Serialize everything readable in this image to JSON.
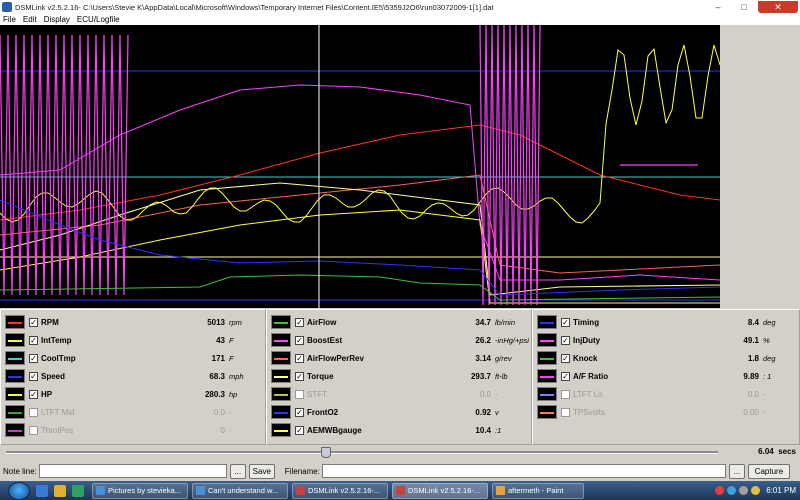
{
  "window": {
    "title": "DSMLink v2.5.2.16- C:\\Users\\Stevie K\\AppData\\Local\\Microsoft\\Windows\\Temporary Internet Files\\Content.IE5\\5359J2O6\\run03072009-1[1].dat",
    "minimize": "–",
    "maximize": "□",
    "close": "✕"
  },
  "menu": [
    "File",
    "Edit",
    "Display",
    "ECU/Logfile"
  ],
  "colors": {
    "chart_bg": "#000000",
    "rpm": "#ff3030",
    "inttemp": "#ffff40",
    "cooltmp": "#40d0d0",
    "speed": "#3030ff",
    "hp": "#ffff40",
    "ltft_mid": "#40a040",
    "throtpos": "#c040c0",
    "airflow": "#40c040",
    "boostest": "#ff40ff",
    "airflowperrev": "#ff6060",
    "torque": "#ffff90",
    "stft": "#c0c040",
    "fronto2": "#3030ff",
    "aemwbgauge": "#ffff40",
    "timing": "#3030ff",
    "injduty": "#ff40ff",
    "knock": "#40c040",
    "afratio": "#ff40ff",
    "ltft_lo": "#8080ff",
    "tpsvolts": "#ff8040"
  },
  "panels": [
    [
      {
        "label": "RPM",
        "value": "5013",
        "unit": "rpm",
        "checked": true,
        "color": "#ff3030"
      },
      {
        "label": "IntTemp",
        "value": "43",
        "unit": "F",
        "checked": true,
        "color": "#ffff40"
      },
      {
        "label": "CoolTmp",
        "value": "171",
        "unit": "F",
        "checked": true,
        "color": "#40d0d0"
      },
      {
        "label": "Speed",
        "value": "68.3",
        "unit": "mph",
        "checked": true,
        "color": "#3030ff"
      },
      {
        "label": "HP",
        "value": "280.3",
        "unit": "hp",
        "checked": true,
        "color": "#ffff40"
      },
      {
        "label": "LTFT Mid",
        "value": "0.0",
        "unit": "-",
        "checked": false,
        "color": "#40a040"
      },
      {
        "label": "ThrotPos",
        "value": "0",
        "unit": "-",
        "checked": false,
        "color": "#c040c0"
      }
    ],
    [
      {
        "label": "AirFlow",
        "value": "34.7",
        "unit": "lb/min",
        "checked": true,
        "color": "#40c040"
      },
      {
        "label": "BoostEst",
        "value": "26.2",
        "unit": "-inHg/+psi",
        "checked": true,
        "color": "#ff40ff"
      },
      {
        "label": "AirFlowPerRev",
        "value": "3.14",
        "unit": "g/rev",
        "checked": true,
        "color": "#ff6060"
      },
      {
        "label": "Torque",
        "value": "293.7",
        "unit": "ft-lb",
        "checked": true,
        "color": "#ffff90"
      },
      {
        "label": "STFT",
        "value": "0.0",
        "unit": "-",
        "checked": false,
        "color": "#c0c040"
      },
      {
        "label": "FrontO2",
        "value": "0.92",
        "unit": "v",
        "checked": true,
        "color": "#3030ff"
      },
      {
        "label": "AEMWBgauge",
        "value": "10.4",
        "unit": ":1",
        "checked": true,
        "color": "#ffff40"
      }
    ],
    [
      {
        "label": "Timing",
        "value": "8.4",
        "unit": "deg",
        "checked": true,
        "color": "#3030ff"
      },
      {
        "label": "InjDuty",
        "value": "49.1",
        "unit": "%",
        "checked": true,
        "color": "#ff40ff"
      },
      {
        "label": "Knock",
        "value": "1.8",
        "unit": "deg",
        "checked": true,
        "color": "#40c040"
      },
      {
        "label": "A/F Ratio",
        "value": "9.89",
        "unit": ": 1",
        "checked": true,
        "color": "#ff40ff"
      },
      {
        "label": "LTFT Lo",
        "value": "0.0",
        "unit": "-",
        "checked": false,
        "color": "#8080ff"
      },
      {
        "label": "TPSvolts",
        "value": "0.00",
        "unit": "-",
        "checked": false,
        "color": "#ff8040"
      }
    ]
  ],
  "slider": {
    "value": "6.04",
    "unit": "secs",
    "position": 0.45
  },
  "noteline": {
    "label": "Note line:",
    "value": "",
    "browse": "...",
    "save": "Save"
  },
  "filename": {
    "label": "Filename:",
    "value": "",
    "browse": "...",
    "capture": "Capture"
  },
  "taskbar": {
    "tasks": [
      {
        "label": "Pictures by stevieka...",
        "color": "#4a90d9"
      },
      {
        "label": "Can't understand w...",
        "color": "#4a90d9"
      },
      {
        "label": "DSMLink v2.5.2.16-...",
        "color": "#c84040"
      },
      {
        "label": "DSMLink v2.5.2.16-...",
        "color": "#c84040"
      },
      {
        "label": "aftermeth - Paint",
        "color": "#e8a040"
      }
    ],
    "clock": "6:01 PM"
  }
}
